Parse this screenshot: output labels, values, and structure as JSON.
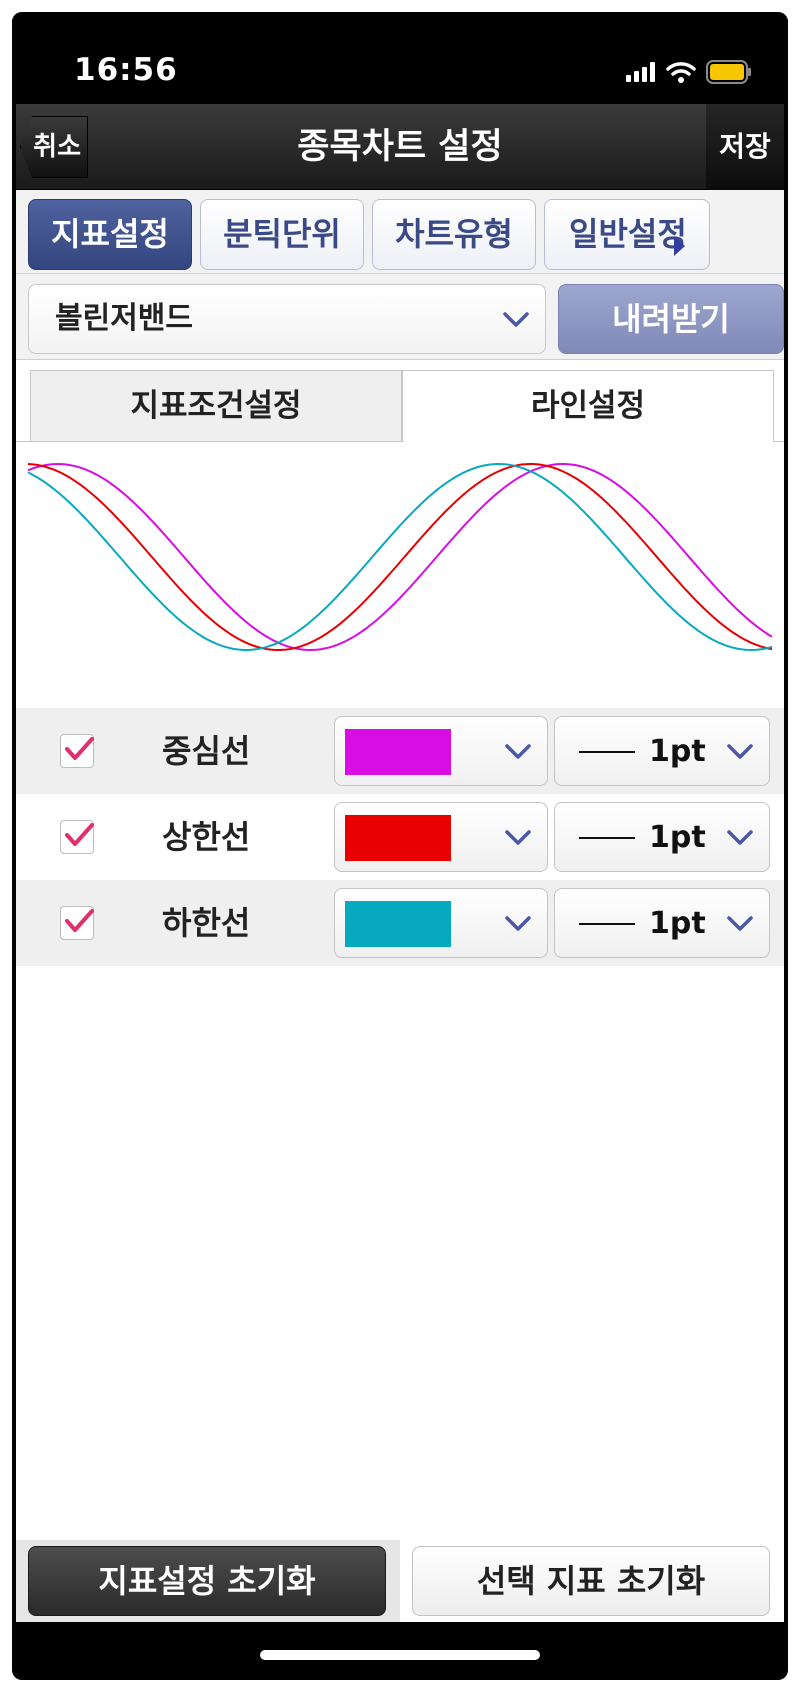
{
  "status_bar": {
    "time": "16:56",
    "icons": [
      "signal-icon",
      "wifi-icon",
      "battery-icon"
    ],
    "battery_color": "#f6c700"
  },
  "nav": {
    "back_label": "취소",
    "title": "종목차트 설정",
    "save_label": "저장"
  },
  "tabs": [
    {
      "label": "지표설정",
      "active": true
    },
    {
      "label": "분틱단위",
      "active": false
    },
    {
      "label": "차트유형",
      "active": false
    },
    {
      "label": "일반설정",
      "active": false
    }
  ],
  "indicator_select": {
    "value": "볼린저밴드",
    "download_label": "내려받기"
  },
  "sub_tabs": [
    {
      "label": "지표조건설정",
      "active": false
    },
    {
      "label": "라인설정",
      "active": true
    }
  ],
  "lines": [
    {
      "label": "중심선",
      "checked": true,
      "color": "#d70de3",
      "width": "1pt"
    },
    {
      "label": "상한선",
      "checked": true,
      "color": "#e80000",
      "width": "1pt"
    },
    {
      "label": "하한선",
      "checked": true,
      "color": "#07a9bf",
      "width": "1pt"
    }
  ],
  "bottom": {
    "reset_all_label": "지표설정 초기화",
    "reset_selected_label": "선택 지표 초기화"
  },
  "colors": {
    "accent": "#33467f",
    "accent_text": "#3a4a86",
    "check": "#e0306a",
    "chevron": "#4a58a6"
  }
}
